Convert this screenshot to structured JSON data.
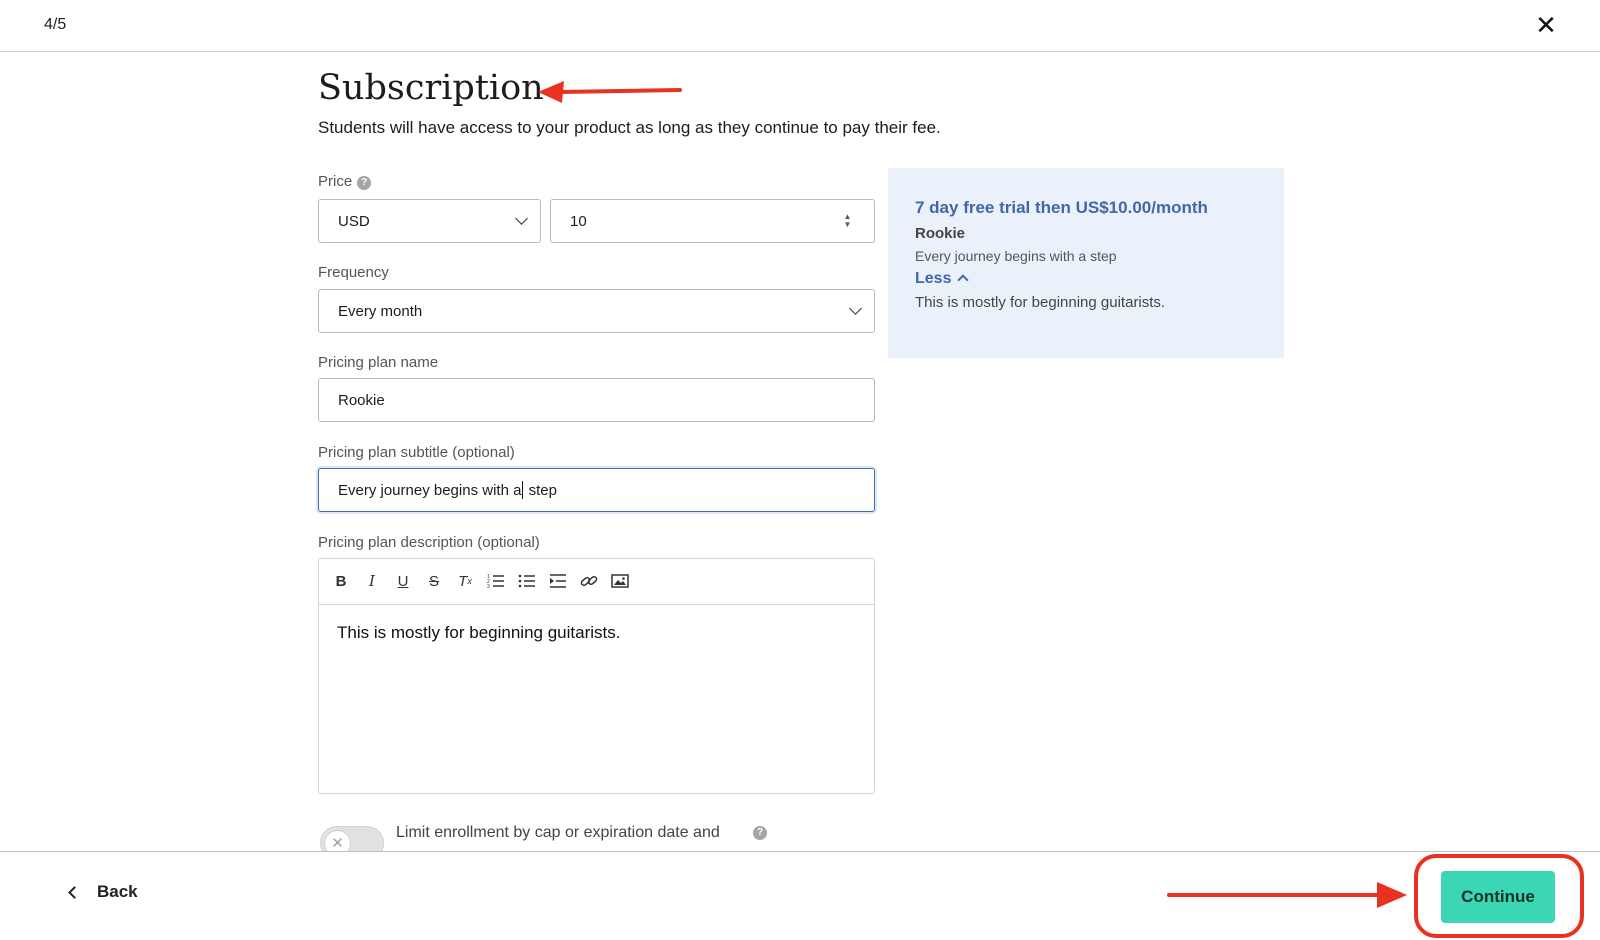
{
  "header": {
    "step": "4/5",
    "close_icon": "close-icon"
  },
  "page": {
    "title": "Subscription",
    "lead": "Students will have access to your product as long as they continue to pay their fee."
  },
  "form": {
    "price_label": "Price",
    "currency": "USD",
    "amount": "10",
    "frequency_label": "Frequency",
    "frequency": "Every month",
    "plan_name_label": "Pricing plan name",
    "plan_name": "Rookie",
    "subtitle_label": "Pricing plan subtitle (optional)",
    "subtitle_before_caret": "Every journey begins with a",
    "subtitle_after_caret": " step",
    "description_label": "Pricing plan description (optional)",
    "description": "This is mostly for beginning guitarists.",
    "toolbar_icons": [
      "bold-icon",
      "italic-icon",
      "underline-icon",
      "strikethrough-icon",
      "clear-format-icon",
      "ordered-list-icon",
      "bullet-list-icon",
      "indent-icon",
      "link-icon",
      "image-icon"
    ],
    "limit_label": "Limit enrollment by cap or expiration date and",
    "limit_enabled": false
  },
  "preview": {
    "headline": "7 day free trial then US$10.00/month",
    "name": "Rookie",
    "subtitle": "Every journey begins with a step",
    "toggle_label": "Less",
    "description": "This is mostly for beginning guitarists."
  },
  "footer": {
    "back_label": "Back",
    "continue_label": "Continue"
  },
  "colors": {
    "accent": "#3bd6b4",
    "preview_bg": "#ebf1fb",
    "link": "#4267a8",
    "annotation": "#e8321f"
  }
}
